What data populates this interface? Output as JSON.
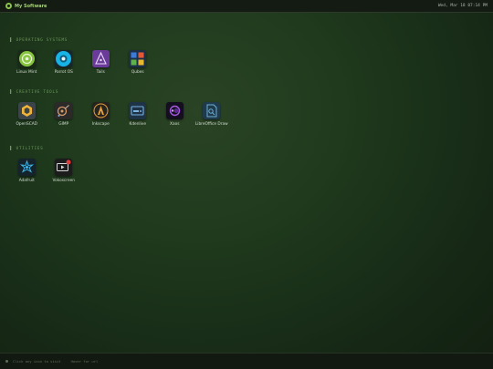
{
  "topbar": {
    "title": "My Software",
    "clock": "Wed, Mar 18 07:14 PM"
  },
  "sections": [
    {
      "title": "▌ OPERATING SYSTEMS",
      "apps": [
        {
          "label": "Linux Mint",
          "icon": "linux-mint-icon"
        },
        {
          "label": "Parrot OS",
          "icon": "parrot-os-icon"
        },
        {
          "label": "Tails",
          "icon": "tails-icon"
        },
        {
          "label": "Qubes",
          "icon": "qubes-icon"
        }
      ]
    },
    {
      "title": "▌ CREATIVE TOOLS",
      "apps": [
        {
          "label": "OpenSCAD",
          "icon": "openscad-icon"
        },
        {
          "label": "GIMP",
          "icon": "gimp-icon"
        },
        {
          "label": "Inkscape",
          "icon": "inkscape-icon"
        },
        {
          "label": "Kdenlive",
          "icon": "kdenlive-icon"
        },
        {
          "label": "Xaos",
          "icon": "xaos-icon"
        },
        {
          "label": "LibreOffice Draw",
          "icon": "libreoffice-draw-icon"
        }
      ]
    },
    {
      "title": "▌ UTILITIES",
      "apps": [
        {
          "label": "Adafruit",
          "icon": "adafruit-icon"
        },
        {
          "label": "Vokoscreen",
          "icon": "vokoscreen-icon"
        }
      ]
    }
  ],
  "bottombar": {
    "hint_click": "Click any icon to visit",
    "hint_hover": "Hover for url"
  }
}
